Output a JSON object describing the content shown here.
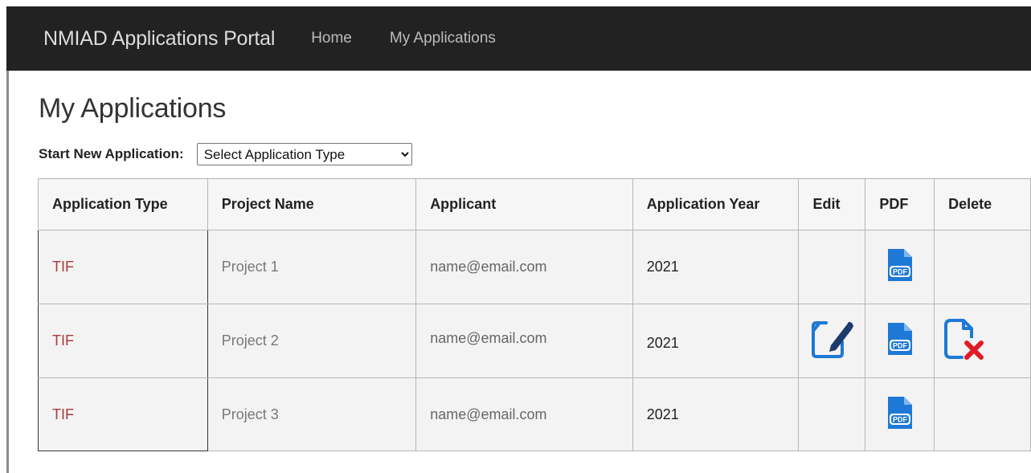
{
  "navbar": {
    "brand": "NMIAD Applications Portal",
    "links": [
      "Home",
      "My Applications"
    ]
  },
  "page": {
    "title": "My Applications",
    "start_label": "Start New Application:",
    "select_value": "Select Application Type"
  },
  "table": {
    "headers": [
      "Application Type",
      "Project Name",
      "Applicant",
      "Application Year",
      "Edit",
      "PDF",
      "Delete"
    ],
    "rows": [
      {
        "type": "TIF",
        "project": "Project 1",
        "applicant": "name@email.com",
        "year": "2021",
        "edit": false,
        "pdf": true,
        "delete": false
      },
      {
        "type": "TIF",
        "project": "Project 2",
        "applicant": "name@email.com",
        "year": "2021",
        "edit": true,
        "pdf": true,
        "delete": true
      },
      {
        "type": "TIF",
        "project": "Project 3",
        "applicant": "name@email.com",
        "year": "2021",
        "edit": false,
        "pdf": true,
        "delete": false
      }
    ]
  },
  "icons": {
    "edit": "edit-document-icon",
    "pdf": "pdf-file-icon",
    "delete": "delete-document-icon"
  },
  "colors": {
    "navbar_bg": "#222222",
    "icon_blue": "#1e79d6",
    "type_text": "#a83a3a",
    "delete_red": "#e01b24"
  }
}
